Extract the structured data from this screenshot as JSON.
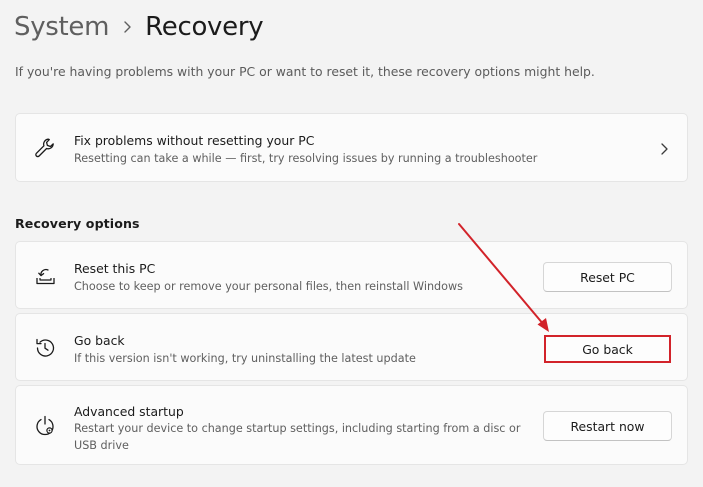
{
  "breadcrumb": {
    "parent": "System",
    "current": "Recovery"
  },
  "intro": "If you're having problems with your PC or want to reset it, these recovery options might help.",
  "fix_card": {
    "title": "Fix problems without resetting your PC",
    "description": "Resetting can take a while — first, try resolving issues by running a troubleshooter",
    "icon": "wrench-icon"
  },
  "section": {
    "title": "Recovery options"
  },
  "options": [
    {
      "title": "Reset this PC",
      "description": "Choose to keep or remove your personal files, then reinstall Windows",
      "button": "Reset PC",
      "icon": "reset-pc-icon"
    },
    {
      "title": "Go back",
      "description": "If this version isn't working, try uninstalling the latest update",
      "button": "Go back",
      "icon": "history-icon"
    },
    {
      "title": "Advanced startup",
      "description": "Restart your device to change startup settings, including starting from a disc or USB drive",
      "button": "Restart now",
      "icon": "advanced-startup-icon"
    }
  ],
  "annotation": {
    "arrow_color": "#d2232a",
    "highlight_color": "#d2232a"
  }
}
